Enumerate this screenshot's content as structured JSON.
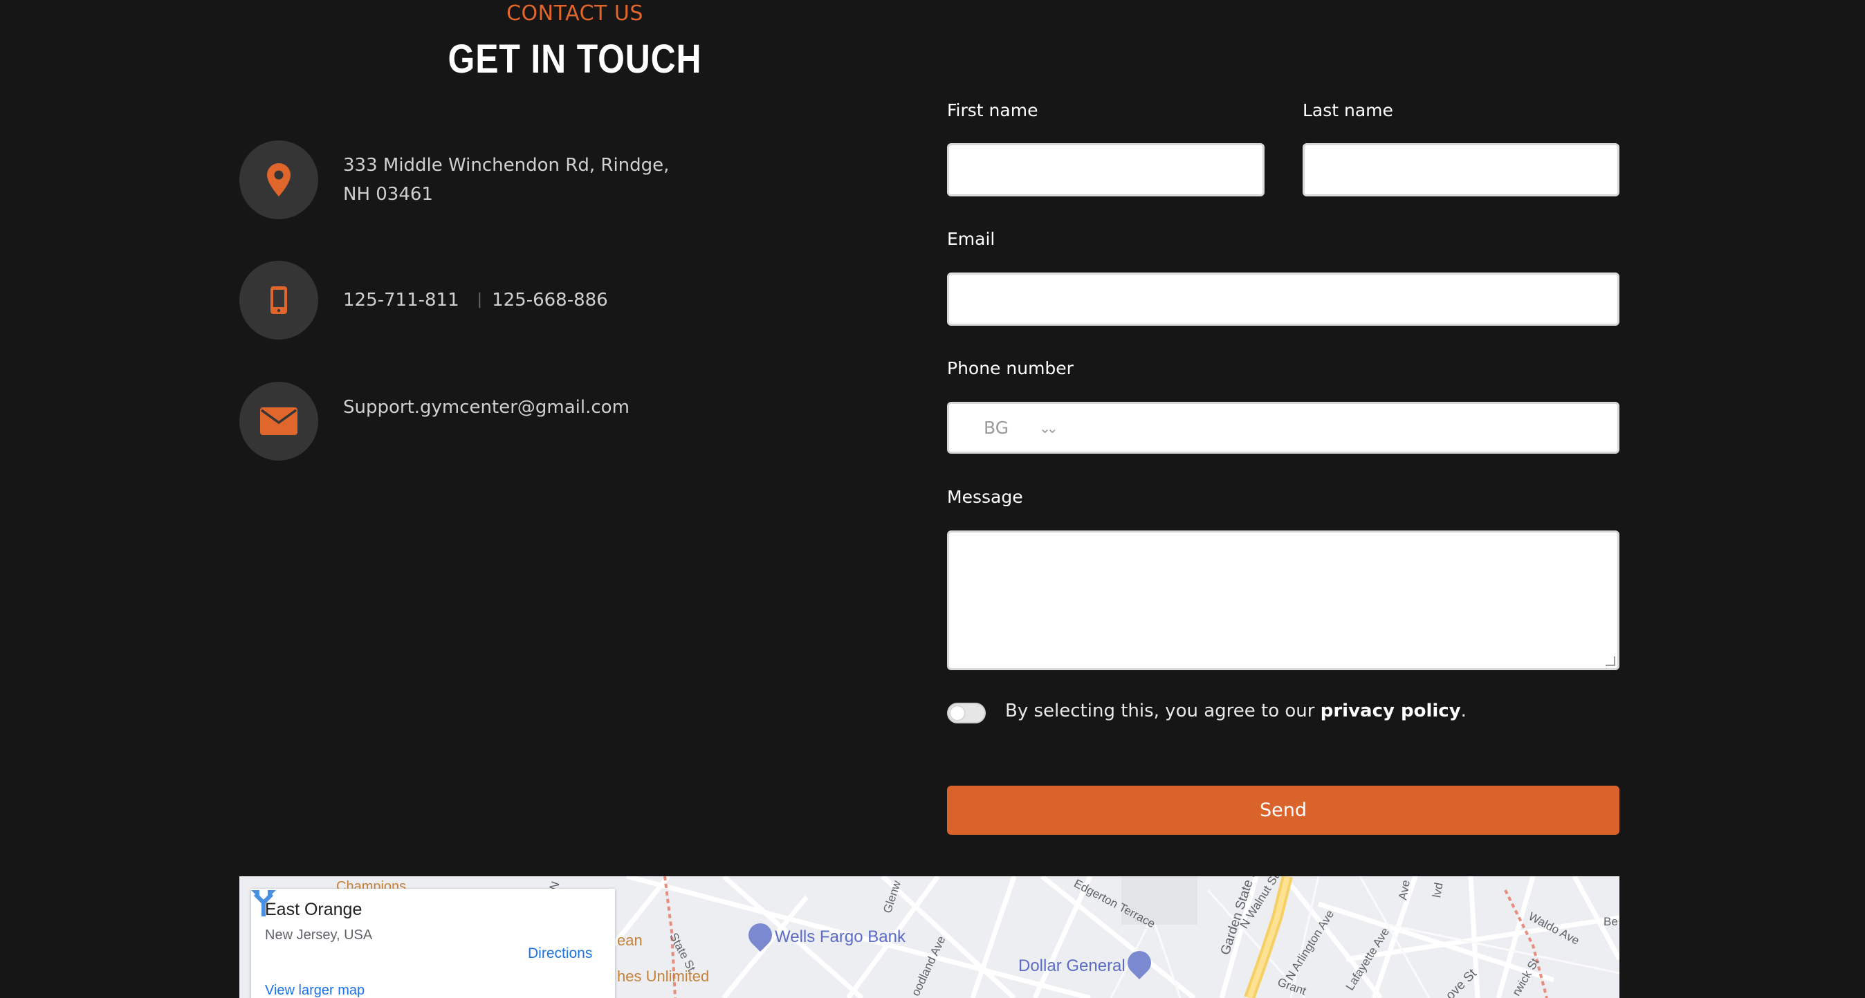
{
  "header": {
    "eyebrow": "CONTACT US",
    "title": "GET IN TOUCH"
  },
  "contact_info": {
    "address_line1": "333 Middle Winchendon Rd, Rindge,",
    "address_line2": "NH 03461",
    "phone1": "125-711-811",
    "phone_separator": "|",
    "phone2": "125-668-886",
    "email": "Support.gymcenter@gmail.com",
    "icons": [
      "map-pin-icon",
      "mobile-phone-icon",
      "envelope-icon"
    ],
    "accent_color": "#e0662c"
  },
  "form": {
    "first_name_label": "First name",
    "first_name_value": "",
    "last_name_label": "Last name",
    "last_name_value": "",
    "email_label": "Email",
    "email_value": "",
    "phone_label": "Phone number",
    "phone_country": "BG",
    "phone_value": "",
    "message_label": "Message",
    "message_value": "",
    "consent_prefix": "By selecting this, you agree to our ",
    "consent_link": "privacy policy",
    "consent_suffix": ".",
    "consent_checked": false,
    "send_label": "Send",
    "send_color": "#da622b"
  },
  "map": {
    "place_name": "East Orange",
    "place_region": "New Jersey, USA",
    "directions_label": "Directions",
    "larger_map_label": "View larger map",
    "poi_labels": [
      "Wells Fargo Bank",
      "Dollar General",
      "Champions",
      "ean",
      "hes Unlimited"
    ],
    "street_labels": [
      "Edgerton Terrace",
      "Garden State P",
      "N Walnut St",
      "N Arlington Ave",
      "Lafayette Ave",
      "Waldo Ave",
      "Glenw",
      "oodland Ave",
      "State St",
      "Grant",
      "ove St",
      "rwick St",
      "Be",
      "Ave",
      "lvd",
      "N"
    ]
  }
}
